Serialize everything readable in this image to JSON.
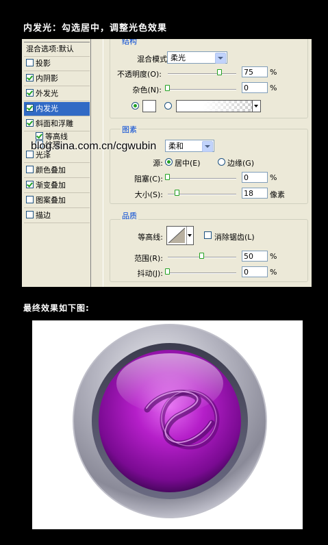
{
  "heading": "内发光：勾选居中，调整光色效果",
  "result_heading": "最终效果如下图:",
  "watermark": "blog.sina.com.cn/cgwubin",
  "style_list": {
    "header": "混合选项:默认",
    "items": [
      {
        "label": "投影",
        "checked": false
      },
      {
        "label": "内阴影",
        "checked": true
      },
      {
        "label": "外发光",
        "checked": true
      },
      {
        "label": "内发光",
        "checked": true,
        "selected": true
      },
      {
        "label": "斜面和浮雕",
        "checked": true
      },
      {
        "label": "等高线",
        "checked": true,
        "sub": true
      },
      {
        "label": "纹理",
        "checked": false,
        "sub": true
      },
      {
        "label": "光泽",
        "checked": false
      },
      {
        "label": "颜色叠加",
        "checked": false
      },
      {
        "label": "渐变叠加",
        "checked": true
      },
      {
        "label": "图案叠加",
        "checked": false
      },
      {
        "label": "描边",
        "checked": false
      }
    ]
  },
  "structure": {
    "title": "结构",
    "blend_mode_label": "混合模式(B):",
    "blend_mode_value": "柔光",
    "opacity_label": "不透明度(O):",
    "opacity_value": "75",
    "noise_label": "杂色(N):",
    "noise_value": "0",
    "percent": "%"
  },
  "elements": {
    "title": "图素",
    "technique_value": "柔和",
    "source_label": "源:",
    "center_label": "居中(E)",
    "edge_label": "边缘(G)",
    "choke_label": "阻塞(C):",
    "choke_value": "0",
    "size_label": "大小(S):",
    "size_value": "18",
    "size_unit": "像素",
    "percent": "%"
  },
  "quality": {
    "title": "品质",
    "contour_label": "等高线:",
    "antialias_label": "消除锯齿(L)",
    "range_label": "范围(R):",
    "range_value": "50",
    "jitter_label": "抖动(J):",
    "jitter_value": "0",
    "percent": "%"
  },
  "colors": {
    "selection": "#316AC5",
    "dialog_bg": "#ECE9D8",
    "group_title": "#0046D5",
    "glow_purple": "#B51FC9"
  }
}
